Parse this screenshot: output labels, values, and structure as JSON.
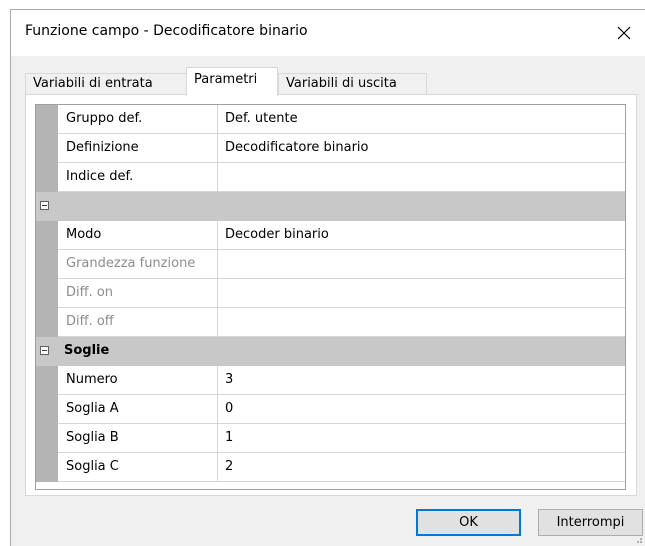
{
  "window": {
    "title": "Funzione campo - Decodificatore binario",
    "close_icon": "close-icon"
  },
  "tabs": [
    {
      "label": "Variabili di entrata",
      "active": false
    },
    {
      "label": "Parametri",
      "active": true
    },
    {
      "label": "Variabili di uscita",
      "active": false
    }
  ],
  "grid": {
    "rows": [
      {
        "name": "Gruppo def.",
        "value": "Def. utente"
      },
      {
        "name": "Definizione",
        "value": "Decodificatore binario"
      },
      {
        "name": "Indice def.",
        "value": ""
      }
    ],
    "category1": {
      "label": ""
    },
    "rows2": [
      {
        "name": "Modo",
        "value": "Decoder binario"
      },
      {
        "name": "Grandezza funzione",
        "value": "",
        "disabled": true
      },
      {
        "name": "Diff. on",
        "value": "",
        "disabled": true
      },
      {
        "name": "Diff. off",
        "value": "",
        "disabled": true
      }
    ],
    "category2": {
      "label": "Soglie"
    },
    "rows3": [
      {
        "name": "Numero",
        "value": "3"
      },
      {
        "name": "Soglia A",
        "value": "0"
      },
      {
        "name": "Soglia B",
        "value": "1"
      },
      {
        "name": "Soglia C",
        "value": "2"
      }
    ]
  },
  "buttons": {
    "ok_label": "OK",
    "cancel_label": "Interrompi"
  },
  "colors": {
    "accent": "#0078d7",
    "gutter": "#b4b4b4",
    "category": "#c8c8c8",
    "disabled_text": "#8c8c8c"
  }
}
